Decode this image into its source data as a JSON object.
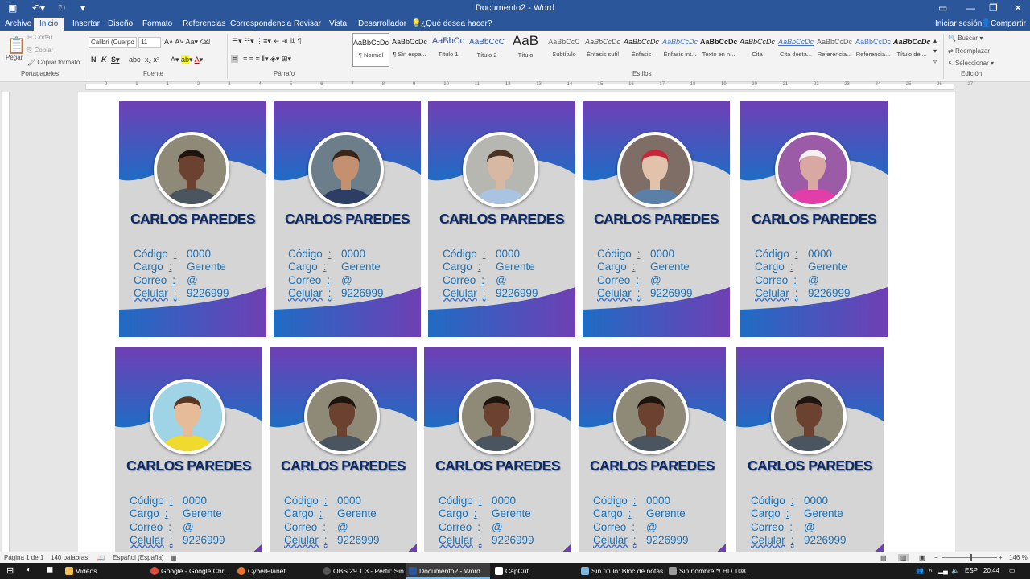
{
  "window": {
    "title": "Documento2 - Word",
    "signin": "Iniciar sesión",
    "share": "Compartir"
  },
  "tabs": [
    "Archivo",
    "Inicio",
    "Insertar",
    "Diseño",
    "Formato",
    "Referencias",
    "Correspondencia",
    "Revisar",
    "Vista",
    "Desarrollador"
  ],
  "tellme": "¿Qué desea hacer?",
  "clipboard": {
    "paste": "Pegar",
    "cut": "Cortar",
    "copy": "Copiar",
    "format": "Copiar formato",
    "group": "Portapapeles"
  },
  "font": {
    "name": "Calibri (Cuerpo",
    "size": "11",
    "group": "Fuente"
  },
  "paragraph": {
    "group": "Párrafo"
  },
  "styles": {
    "group": "Estilos",
    "items": [
      {
        "preview": "AaBbCcDc",
        "name": "¶ Normal"
      },
      {
        "preview": "AaBbCcDc",
        "name": "¶ Sin espa..."
      },
      {
        "preview": "AaBbCc",
        "name": "Título 1"
      },
      {
        "preview": "AaBbCcC",
        "name": "Título 2"
      },
      {
        "preview": "AaB",
        "name": "Título"
      },
      {
        "preview": "AaBbCcC",
        "name": "Subtítulo"
      },
      {
        "preview": "AaBbCcDc",
        "name": "Énfasis sutil"
      },
      {
        "preview": "AaBbCcDc",
        "name": "Énfasis"
      },
      {
        "preview": "AaBbCcDc",
        "name": "Énfasis int..."
      },
      {
        "preview": "AaBbCcDc",
        "name": "Texto en n..."
      },
      {
        "preview": "AaBbCcDc",
        "name": "Cita"
      },
      {
        "preview": "AaBbCcDc",
        "name": "Cita desta..."
      },
      {
        "preview": "AaBbCcDc",
        "name": "Referencia..."
      },
      {
        "preview": "AaBbCcDc",
        "name": "Referencia..."
      },
      {
        "preview": "AaBbCcDc",
        "name": "Título del..."
      }
    ]
  },
  "editing": {
    "find": "Buscar",
    "replace": "Reemplazar",
    "select": "Seleccionar",
    "group": "Edición"
  },
  "ruler": [
    "2",
    "1",
    "1",
    "2",
    "3",
    "4",
    "5",
    "6",
    "7",
    "8",
    "9",
    "10",
    "11",
    "12",
    "13",
    "14",
    "15",
    "16",
    "17",
    "18",
    "19",
    "20",
    "21",
    "22",
    "23",
    "24",
    "25",
    "26",
    "27"
  ],
  "card": {
    "name": "CARLOS PAREDES",
    "rows": [
      {
        "label": "Código",
        "sep": ":",
        "value": "0000"
      },
      {
        "label": "Cargo",
        "sep": ":",
        "value": "Gerente"
      },
      {
        "label": "Correo",
        "sep": ":",
        "value": "@"
      },
      {
        "label": "Celular",
        "sep": ":",
        "value": "9226999"
      }
    ],
    "colors": {
      "purple": "#6f3fb5",
      "blue": "#1f6cc4",
      "gray": "#d5d5d5",
      "name": "#0c2b6b",
      "text": "#1d73b8"
    }
  },
  "status": {
    "page": "Página 1 de 1",
    "words": "140 palabras",
    "lang": "Español (España)",
    "zoom": "146 %"
  },
  "taskbar": {
    "items": [
      "Vídeos",
      "Google - Google Chr...",
      "CyberPlanet",
      "OBS 29.1.3 - Perfil: Sin...",
      "Documento2 - Word",
      "CapCut",
      "Sin título: Bloc de notas",
      "Sin nombre */ HD 108..."
    ],
    "lang": "ESP",
    "time": "20:44"
  }
}
